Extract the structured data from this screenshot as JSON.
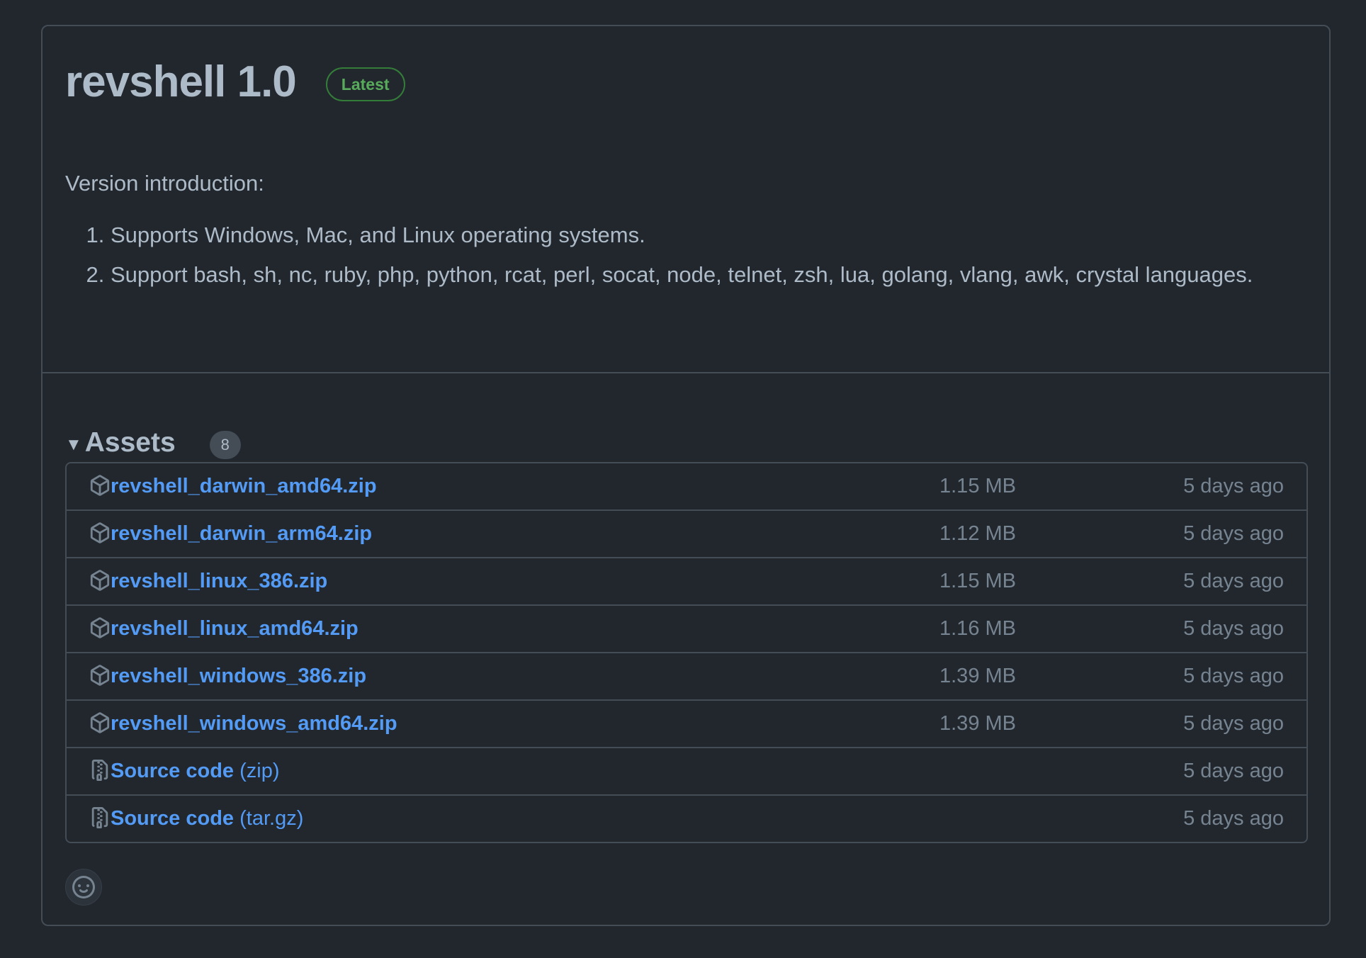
{
  "release": {
    "title": "revshell 1.0",
    "badge": "Latest",
    "intro": "Version introduction:",
    "notes": [
      "Supports Windows, Mac, and Linux operating systems.",
      "Support bash, sh, nc, ruby, php, python, rcat, perl, socat, node, telnet, zsh, lua, golang, vlang, awk, crystal languages."
    ]
  },
  "assets": {
    "title": "Assets",
    "count": "8",
    "items": [
      {
        "name": "revshell_darwin_amd64.zip",
        "size": "1.15 MB",
        "date": "5 days ago",
        "icon": "package-icon"
      },
      {
        "name": "revshell_darwin_arm64.zip",
        "size": "1.12 MB",
        "date": "5 days ago",
        "icon": "package-icon"
      },
      {
        "name": "revshell_linux_386.zip",
        "size": "1.15 MB",
        "date": "5 days ago",
        "icon": "package-icon"
      },
      {
        "name": "revshell_linux_amd64.zip",
        "size": "1.16 MB",
        "date": "5 days ago",
        "icon": "package-icon"
      },
      {
        "name": "revshell_windows_386.zip",
        "size": "1.39 MB",
        "date": "5 days ago",
        "icon": "package-icon"
      },
      {
        "name": "revshell_windows_amd64.zip",
        "size": "1.39 MB",
        "date": "5 days ago",
        "icon": "package-icon"
      },
      {
        "name": "Source code",
        "suffix": "(zip)",
        "date": "5 days ago",
        "icon": "file-zip-icon"
      },
      {
        "name": "Source code",
        "suffix": "(tar.gz)",
        "date": "5 days ago",
        "icon": "file-zip-icon"
      }
    ]
  },
  "reactions": {
    "icon": "smiley-icon"
  },
  "colors": {
    "background": "#22272e",
    "border": "#444c56",
    "link": "#539bf5",
    "muted": "#768390",
    "text": "#adbac7",
    "latest_badge": "#57ab5a"
  }
}
